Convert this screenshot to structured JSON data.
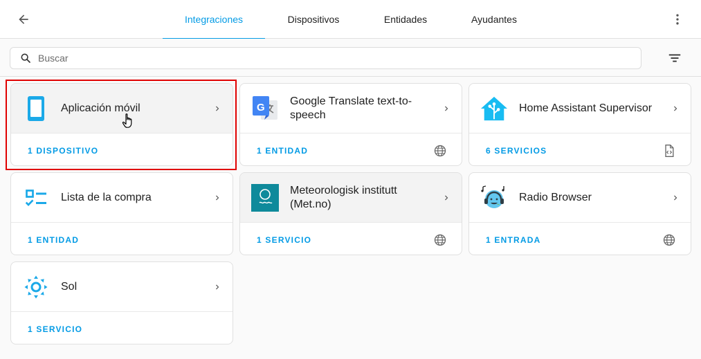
{
  "header": {
    "back_icon": "arrow-left-icon",
    "tabs": [
      {
        "label": "Integraciones",
        "active": true
      },
      {
        "label": "Dispositivos",
        "active": false
      },
      {
        "label": "Entidades",
        "active": false
      },
      {
        "label": "Ayudantes",
        "active": false
      }
    ],
    "menu_icon": "dots-vertical-icon"
  },
  "search": {
    "placeholder": "Buscar",
    "value": "",
    "icon": "search-icon",
    "filter_icon": "filter-icon"
  },
  "colors": {
    "accent": "#039be5",
    "highlight": "#e00000"
  },
  "integrations": [
    {
      "title": "Aplicación móvil",
      "link": "1 DISPOSITIVO",
      "logo": "mobile-phone-icon",
      "badge": null,
      "hovered": true,
      "highlighted": true
    },
    {
      "title": "Google Translate text-to-speech",
      "link": "1 ENTIDAD",
      "logo": "google-translate-icon",
      "badge": "globe-icon"
    },
    {
      "title": "Home Assistant Supervisor",
      "link": "6 SERVICIOS",
      "logo": "home-assistant-icon",
      "badge": "file-code-icon"
    },
    {
      "title": "Lista de la compra",
      "link": "1 ENTIDAD",
      "logo": "format-list-checks-icon",
      "badge": null
    },
    {
      "title": "Meteorologisk institutt (Met.no)",
      "link": "1 SERVICIO",
      "logo": "met-no-icon",
      "badge": "globe-icon",
      "hovered": true
    },
    {
      "title": "Radio Browser",
      "link": "1 ENTRADA",
      "logo": "radio-browser-icon",
      "badge": "globe-icon"
    },
    {
      "title": "Sol",
      "link": "1 SERVICIO",
      "logo": "sun-icon",
      "badge": null
    }
  ]
}
